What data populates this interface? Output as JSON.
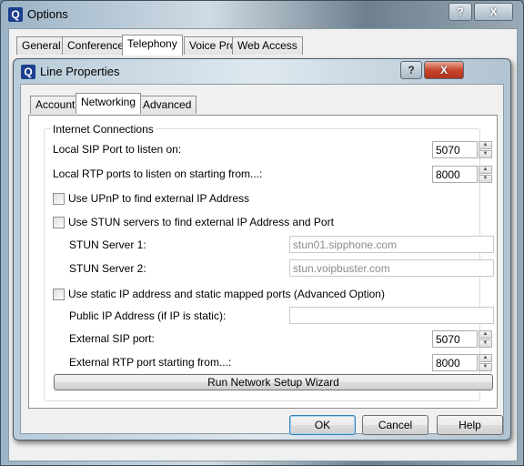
{
  "outer": {
    "title": "Options",
    "help": "?",
    "close": "X",
    "tabs": [
      "General",
      "Conferences",
      "Telephony",
      "Voice Prompts",
      "Web Access"
    ],
    "selected_tab": "Telephony"
  },
  "dialog": {
    "title": "Line Properties",
    "help": "?",
    "close": "X",
    "tabs": [
      "Account",
      "Networking",
      "Advanced"
    ],
    "selected_tab": "Networking",
    "group_title": "Internet Connections",
    "local_sip_label": "Local SIP Port to listen on:",
    "local_sip_value": "5070",
    "local_rtp_label": "Local RTP ports to listen on starting from...:",
    "local_rtp_value": "8000",
    "upnp_label": "Use UPnP to find external IP Address",
    "upnp_checked": false,
    "stun_label": "Use STUN servers to find external IP Address and Port",
    "stun_checked": false,
    "stun1_label": "STUN Server 1:",
    "stun1_value": "stun01.sipphone.com",
    "stun2_label": "STUN Server 2:",
    "stun2_value": "stun.voipbuster.com",
    "static_label": "Use static IP address and static mapped ports (Advanced Option)",
    "static_checked": false,
    "public_ip_label": "Public IP Address (if IP is static):",
    "public_ip_value": "",
    "ext_sip_label": "External SIP port:",
    "ext_sip_value": "5070",
    "ext_rtp_label": "External RTP port starting from...:",
    "ext_rtp_value": "8000",
    "wizard_button": "Run Network Setup Wizard",
    "ok": "OK",
    "cancel": "Cancel",
    "help_button": "Help"
  }
}
